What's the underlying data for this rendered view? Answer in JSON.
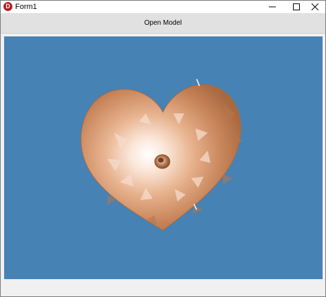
{
  "window": {
    "title": "Form1",
    "app_icon_letter": "D"
  },
  "toolbar": {
    "open_model_label": "Open Model"
  },
  "viewport": {
    "background": "#4682b4",
    "model_icon": "heart-gear-3d-model",
    "model_color": "#c8855a"
  },
  "controls": {
    "minimize_icon": "minimize-icon",
    "maximize_icon": "maximize-icon",
    "close_icon": "close-icon"
  }
}
